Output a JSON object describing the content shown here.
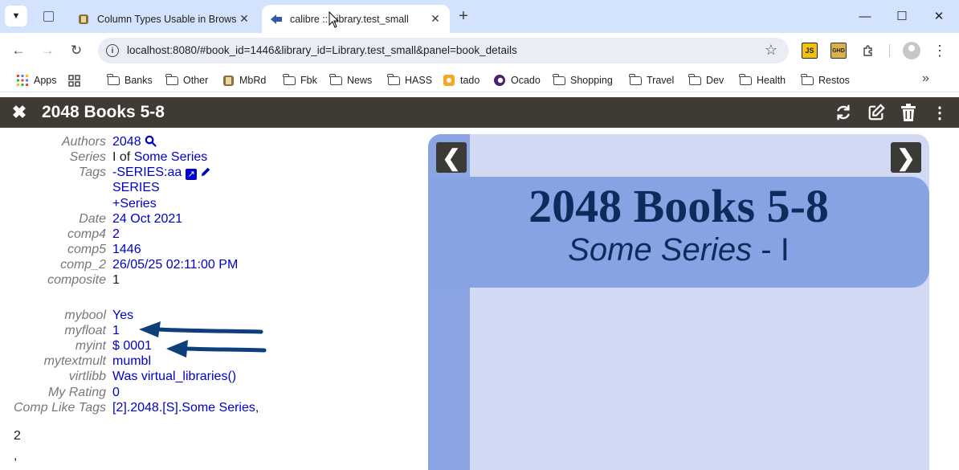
{
  "browser": {
    "tabs": [
      {
        "title": "Column Types Usable in Browse",
        "active": false
      },
      {
        "title": "calibre :: Library.test_small",
        "active": true
      }
    ],
    "url": "localhost:8080/#book_id=1446&library_id=Library.test_small&panel=book_details",
    "bookmarks": [
      "Apps",
      "Banks",
      "Other",
      "MbRd",
      "Fbk",
      "News",
      "HASS",
      "tado",
      "Ocado",
      "Shopping",
      "Travel",
      "Dev",
      "Health",
      "Restos"
    ],
    "extensions": {
      "js": "JS",
      "ghd": "GHD"
    }
  },
  "app": {
    "title": "2048 Books 5-8"
  },
  "details": {
    "authors": {
      "label": "Authors",
      "value": "2048"
    },
    "series": {
      "label": "Series",
      "index": "I of",
      "value": "Some Series"
    },
    "tags": {
      "label": "Tags",
      "values": [
        "-SERIES:aa",
        "SERIES",
        "+Series"
      ]
    },
    "date": {
      "label": "Date",
      "value": "24 Oct 2021"
    },
    "comp4": {
      "label": "comp4",
      "value": "2"
    },
    "comp5": {
      "label": "comp5",
      "value": "1446"
    },
    "comp_2": {
      "label": "comp_2",
      "value": "26/05/25 02:11:00 PM"
    },
    "composite": {
      "label": "composite",
      "value": "1"
    },
    "mybool": {
      "label": "mybool",
      "value": "Yes"
    },
    "myfloat": {
      "label": "myfloat",
      "value": "1"
    },
    "myint": {
      "label": "myint",
      "value": "$ 0001"
    },
    "mytextmult": {
      "label": "mytextmult",
      "value": "mumbl"
    },
    "virtlibb": {
      "label": "virtlibb",
      "value": "Was virtual_libraries()"
    },
    "my_rating": {
      "label": "My Rating",
      "value": "0"
    },
    "comp_like_tags": {
      "label": "Comp Like Tags",
      "value": "[2].2048.[S].Some Series",
      "suffix": ","
    },
    "trailing": [
      "2",
      ","
    ]
  },
  "cover": {
    "title": "2048 Books 5-8",
    "series": "Some Series",
    "separator": " - ",
    "index": "I",
    "colors": {
      "bg": "#d2daf3",
      "banner": "#88a3e4",
      "text": "#0c2d5c"
    }
  },
  "colors": {
    "link": "#0000cc",
    "label": "#777777",
    "appbar": "#3f3a33",
    "arrow": "#0d3f7a"
  }
}
